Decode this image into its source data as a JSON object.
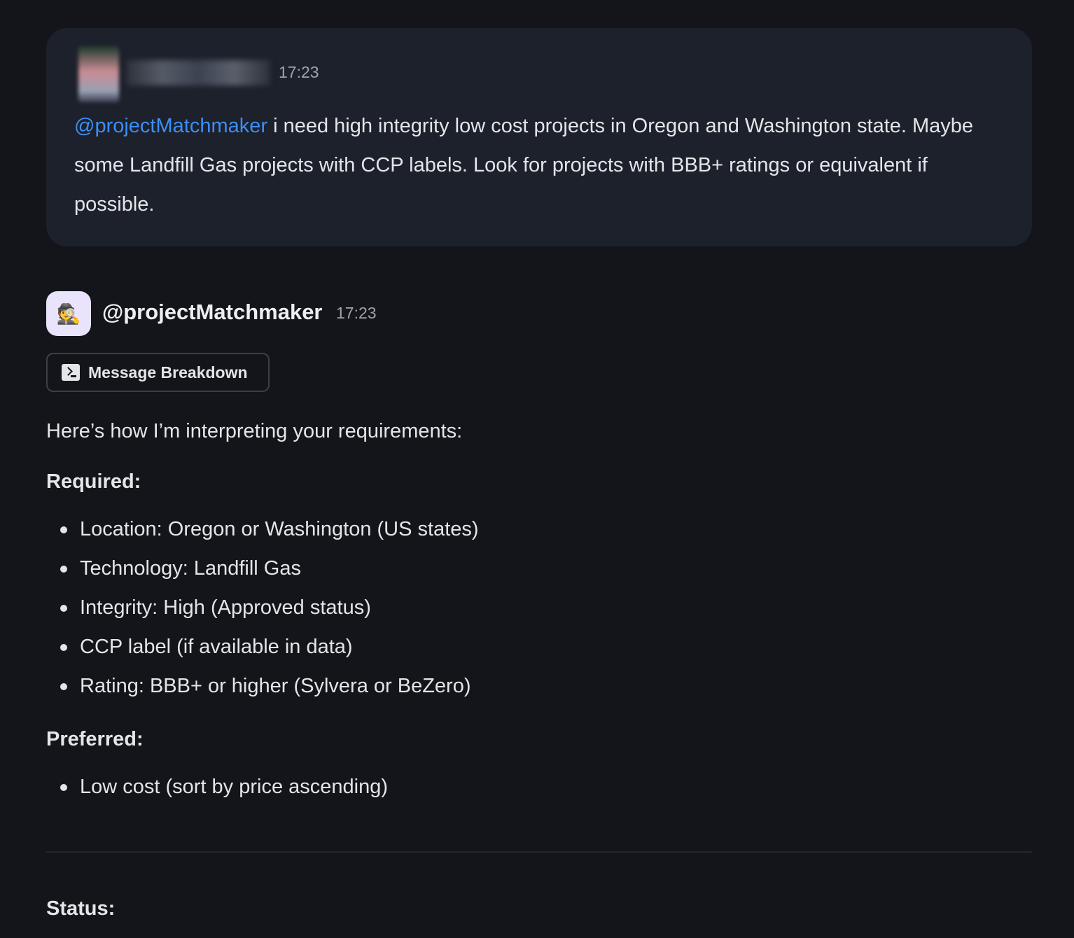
{
  "user_message": {
    "time": "17:23",
    "mention": "@projectMatchmaker",
    "text": " i need high integrity low cost projects in Oregon and Washington state. Maybe some Landfill Gas projects with CCP labels. Look for projects with BBB+ ratings or equivalent if possible."
  },
  "bot": {
    "name": "@projectMatchmaker",
    "time": "17:23",
    "avatar_icon": "🕵️",
    "breakdown_label": "Message Breakdown"
  },
  "response": {
    "intro": "Here’s how I’m interpreting your requirements:",
    "required_heading": "Required:",
    "required_items": [
      "Location: Oregon or Washington (US states)",
      "Technology: Landfill Gas",
      "Integrity: High (Approved status)",
      "CCP label (if available in data)",
      "Rating: BBB+ or higher (Sylvera or BeZero)"
    ],
    "preferred_heading": "Preferred:",
    "preferred_items": [
      "Low cost (sort by price ascending)"
    ],
    "status_heading": "Status:"
  },
  "colors": {
    "background": "#13151a",
    "card": "#1d212b",
    "mention": "#3d8ef5",
    "bot_avatar_bg": "#e9e3fb"
  }
}
